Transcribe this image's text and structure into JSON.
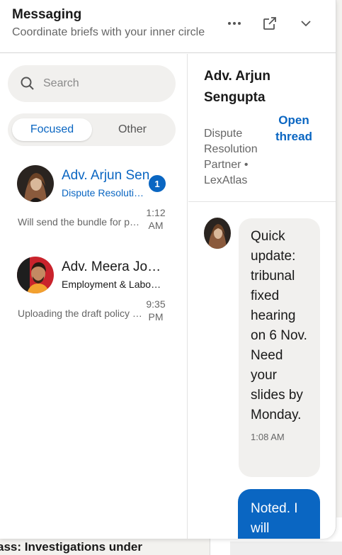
{
  "header": {
    "title": "Messaging",
    "subtitle": "Coordinate briefs with your inner circle",
    "more_icon": "more-horizontal-icon",
    "popout_icon": "pop-out-icon",
    "collapse_icon": "chevron-down-icon"
  },
  "search": {
    "placeholder": "Search",
    "icon": "search-icon"
  },
  "tabs": {
    "focused": "Focused",
    "other": "Other",
    "active": "Focused"
  },
  "conversations": [
    {
      "name": "Adv. Arjun Sengupta",
      "subtitle": "Dispute Resolution Partner",
      "preview": "Will send the bundle for pre-filing",
      "time": "1:12 AM",
      "unread": "1",
      "name_color": "#0a66c2"
    },
    {
      "name": "Adv. Meera Joshi",
      "subtitle": "Employment & Labour Counsel",
      "preview": "Uploading the draft policy notes",
      "time": "9:35 PM",
      "name_color": "#191919"
    }
  ],
  "active_thread": {
    "name": "Adv. Arjun Sengupta",
    "title": "Dispute Resolution Partner • LexAtlas",
    "open_thread_label": "Open thread",
    "messages": [
      {
        "direction": "in",
        "text": "Quick update: tribunal fixed hearing on 6 Nov. Need your slides by Monday.",
        "time": "1:08 AM"
      },
      {
        "direction": "out",
        "text": "Noted. I will circulate"
      }
    ]
  },
  "background": {
    "caption": "ass: Investigations under"
  },
  "colors": {
    "accent": "#0a66c2",
    "bubble_in": "#f1f0ee",
    "bubble_out": "#0a66c2"
  }
}
